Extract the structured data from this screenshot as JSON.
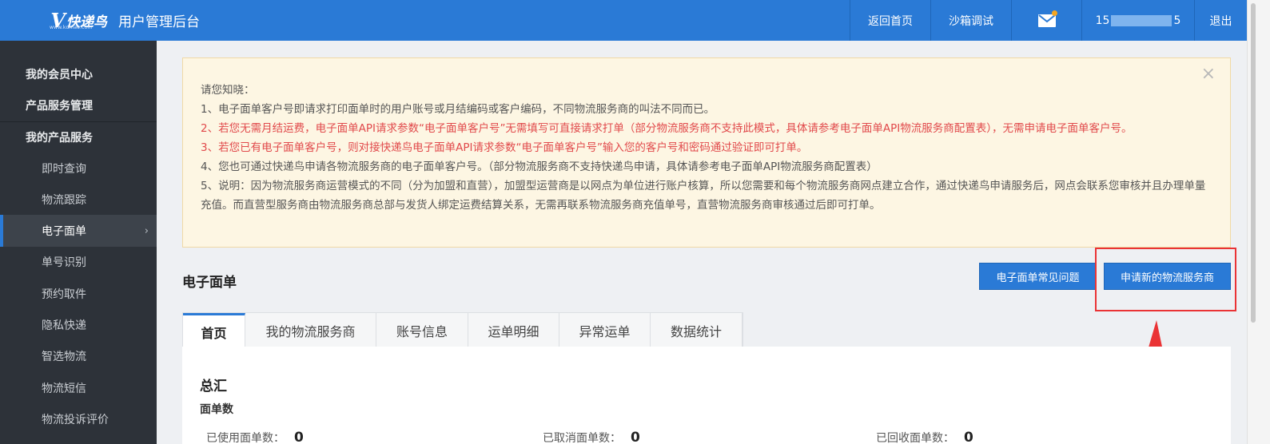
{
  "header": {
    "logo_mark": "V",
    "logo_brand": "快递鸟",
    "logo_sub": "www.kdniao.com",
    "app_title": "用户管理后台",
    "nav": {
      "home": "返回首页",
      "sandbox": "沙箱调试",
      "mail_icon": "envelope-icon",
      "user_prefix": "15",
      "user_suffix": "5",
      "logout": "退出"
    }
  },
  "sidebar": {
    "items": [
      {
        "label": "我的会员中心",
        "type": "group"
      },
      {
        "label": "产品服务管理",
        "type": "group"
      },
      {
        "label": "我的产品服务",
        "type": "group"
      },
      {
        "label": "即时查询",
        "type": "sub"
      },
      {
        "label": "物流跟踪",
        "type": "sub"
      },
      {
        "label": "电子面单",
        "type": "sub",
        "active": true,
        "chevron": "›"
      },
      {
        "label": "单号识别",
        "type": "sub"
      },
      {
        "label": "预约取件",
        "type": "sub"
      },
      {
        "label": "隐私快递",
        "type": "sub"
      },
      {
        "label": "智选物流",
        "type": "sub"
      },
      {
        "label": "物流短信",
        "type": "sub"
      },
      {
        "label": "物流投诉评价",
        "type": "sub"
      }
    ]
  },
  "notice": {
    "close": "×",
    "lines": [
      {
        "text": "请您知晓：",
        "red": false
      },
      {
        "text": "1、电子面单客户号即请求打印面单时的用户账号或月结编码或客户编码，不同物流服务商的叫法不同而已。",
        "red": false
      },
      {
        "text": "2、若您无需月结运费，电子面单API请求参数“电子面单客户号”无需填写可直接请求打单（部分物流服务商不支持此模式，具体请参考电子面单API物流服务商配置表），无需申请电子面单客户号。",
        "red": true
      },
      {
        "text": "3、若您已有电子面单客户号，则对接快递鸟电子面单API请求参数“电子面单客户号”输入您的客户号和密码通过验证即可打单。",
        "red": true
      },
      {
        "text": "4、您也可通过快递鸟申请各物流服务商的电子面单客户号。（部分物流服务商不支持快递鸟申请，具体请参考电子面单API物流服务商配置表）",
        "red": false
      },
      {
        "text": "5、说明：因为物流服务商运营模式的不同（分为加盟和直营），加盟型运营商是以网点为单位进行账户核算，所以您需要和每个物流服务商网点建立合作，通过快递鸟申请服务后，网点会联系您审核并且办理单量充值。而直营型服务商由物流服务商总部与发货人绑定运费结算关系，无需再联系物流服务商充值单号，直营物流服务商审核通过后即可打单。",
        "red": false
      }
    ]
  },
  "section": {
    "title": "电子面单",
    "faq_button": "电子面单常见问题",
    "apply_button": "申请新的物流服务商"
  },
  "tabs": [
    "首页",
    "我的物流服务商",
    "账号信息",
    "运单明细",
    "异常运单",
    "数据统计"
  ],
  "summary": {
    "title": "总汇",
    "count_title": "面单数",
    "stats": [
      {
        "label": "已使用面单数：",
        "value": "0"
      },
      {
        "label": "已取消面单数：",
        "value": "0"
      },
      {
        "label": "已回收面单数：",
        "value": "0"
      }
    ]
  },
  "colors": {
    "header_blue": "#2a7ad6",
    "sidebar_dark": "#2d3239",
    "notice_bg": "#fdf6e3",
    "notice_red": "#e1494b",
    "annotation_red": "#ea3335"
  }
}
